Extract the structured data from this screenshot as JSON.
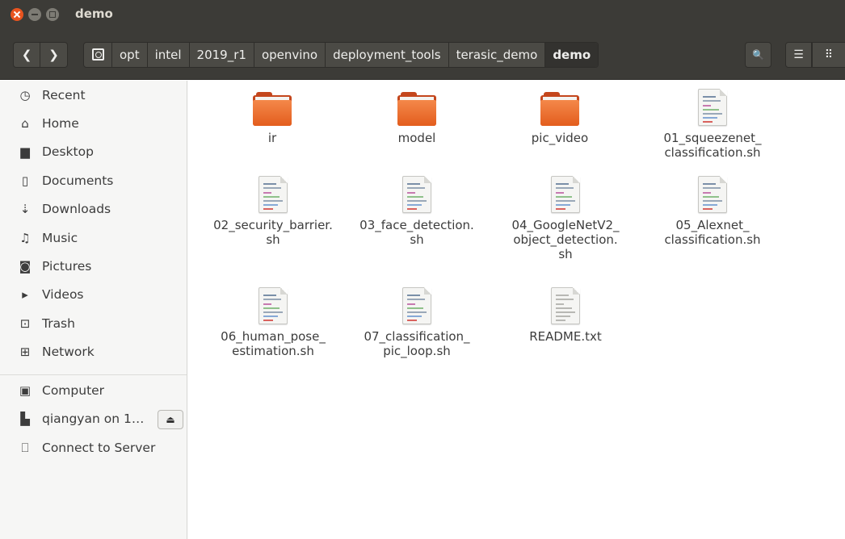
{
  "window": {
    "title": "demo"
  },
  "toolbar": {
    "back_glyph": "❮",
    "forward_glyph": "❯",
    "path": [
      "opt",
      "intel",
      "2019_r1",
      "openvino",
      "deployment_tools",
      "terasic_demo",
      "demo"
    ],
    "search_glyph": "🔍",
    "list_glyph": "☰",
    "grid_glyph": "⠿"
  },
  "sidebar": {
    "items": [
      {
        "label": "Recent",
        "icon": "clock-icon",
        "glyph": "◷"
      },
      {
        "label": "Home",
        "icon": "home-icon",
        "glyph": "⌂"
      },
      {
        "label": "Desktop",
        "icon": "folder-icon",
        "glyph": "▆"
      },
      {
        "label": "Documents",
        "icon": "document-icon",
        "glyph": "▯"
      },
      {
        "label": "Downloads",
        "icon": "download-icon",
        "glyph": "⇣"
      },
      {
        "label": "Music",
        "icon": "music-icon",
        "glyph": "♫"
      },
      {
        "label": "Pictures",
        "icon": "camera-icon",
        "glyph": "◙"
      },
      {
        "label": "Videos",
        "icon": "video-icon",
        "glyph": "▸"
      },
      {
        "label": "Trash",
        "icon": "trash-icon",
        "glyph": "⊡"
      },
      {
        "label": "Network",
        "icon": "network-icon",
        "glyph": "⊞"
      }
    ],
    "devices": [
      {
        "label": "Computer",
        "icon": "drive-icon",
        "glyph": "▣"
      },
      {
        "label": "qiangyan on 1…",
        "icon": "network-share-icon",
        "glyph": "▙",
        "eject_glyph": "⏏"
      },
      {
        "label": "Connect to Server",
        "icon": "server-icon",
        "glyph": "⎕"
      }
    ]
  },
  "files": [
    {
      "name": "ir",
      "type": "folder"
    },
    {
      "name": "model",
      "type": "folder"
    },
    {
      "name": "pic_video",
      "type": "folder"
    },
    {
      "name": "01_squeezenet_\nclassification.sh",
      "type": "script"
    },
    {
      "name": "02_security_barrier.\nsh",
      "type": "script"
    },
    {
      "name": "03_face_detection.\nsh",
      "type": "script"
    },
    {
      "name": "04_GoogleNetV2_\nobject_detection.\nsh",
      "type": "script"
    },
    {
      "name": "05_Alexnet_\nclassification.sh",
      "type": "script"
    },
    {
      "name": "06_human_pose_\nestimation.sh",
      "type": "script"
    },
    {
      "name": "07_classification_\npic_loop.sh",
      "type": "script"
    },
    {
      "name": "README.txt",
      "type": "text"
    }
  ]
}
